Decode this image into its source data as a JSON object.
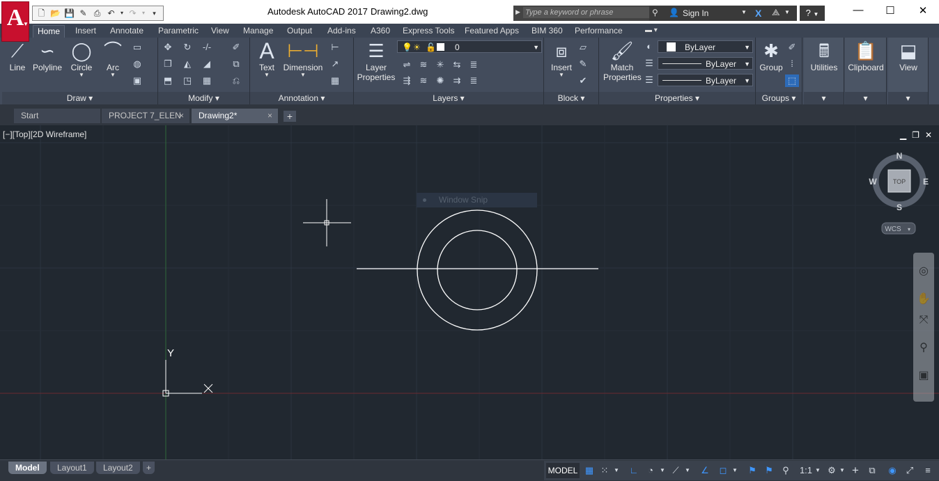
{
  "titlebar": {
    "app_title": "Autodesk AutoCAD 2017",
    "file_name": "Drawing2.dwg",
    "search_placeholder": "Type a keyword or phrase",
    "sign_in": "Sign In",
    "help": "?"
  },
  "app_logo": "A",
  "ribbon_tabs": [
    "Home",
    "Insert",
    "Annotate",
    "Parametric",
    "View",
    "Manage",
    "Output",
    "Add-ins",
    "A360",
    "Express Tools",
    "Featured Apps",
    "BIM 360",
    "Performance"
  ],
  "ribbon": {
    "draw": {
      "title": "Draw",
      "line": "Line",
      "polyline": "Polyline",
      "circle": "Circle",
      "arc": "Arc"
    },
    "modify": {
      "title": "Modify"
    },
    "annotation": {
      "title": "Annotation",
      "text": "Text",
      "dimension": "Dimension"
    },
    "layers": {
      "title": "Layers",
      "layer_properties_1": "Layer",
      "layer_properties_2": "Properties",
      "current_layer": "0"
    },
    "block": {
      "title": "Block",
      "insert": "Insert"
    },
    "properties": {
      "title": "Properties",
      "match_1": "Match",
      "match_2": "Properties",
      "color": "ByLayer",
      "linetype": "ByLayer",
      "lineweight": "ByLayer"
    },
    "groups": {
      "title": "Groups",
      "group": "Group"
    },
    "utilities": "Utilities",
    "clipboard": "Clipboard",
    "view": "View"
  },
  "doc_tabs": [
    {
      "label": "Start"
    },
    {
      "label": "PROJECT 7_ELEN",
      "close": "×"
    },
    {
      "label": "Drawing2*",
      "close": "×"
    }
  ],
  "viewport": {
    "label": "[−][Top][2D Wireframe]",
    "compass": {
      "n": "N",
      "s": "S",
      "e": "E",
      "w": "W",
      "top": "TOP"
    },
    "wcs": "WCS",
    "ucs_y": "Y",
    "snip_label": "Window Snip"
  },
  "layout_tabs": [
    "Model",
    "Layout1",
    "Layout2"
  ],
  "status": {
    "model": "MODEL",
    "scale": "1:1"
  }
}
